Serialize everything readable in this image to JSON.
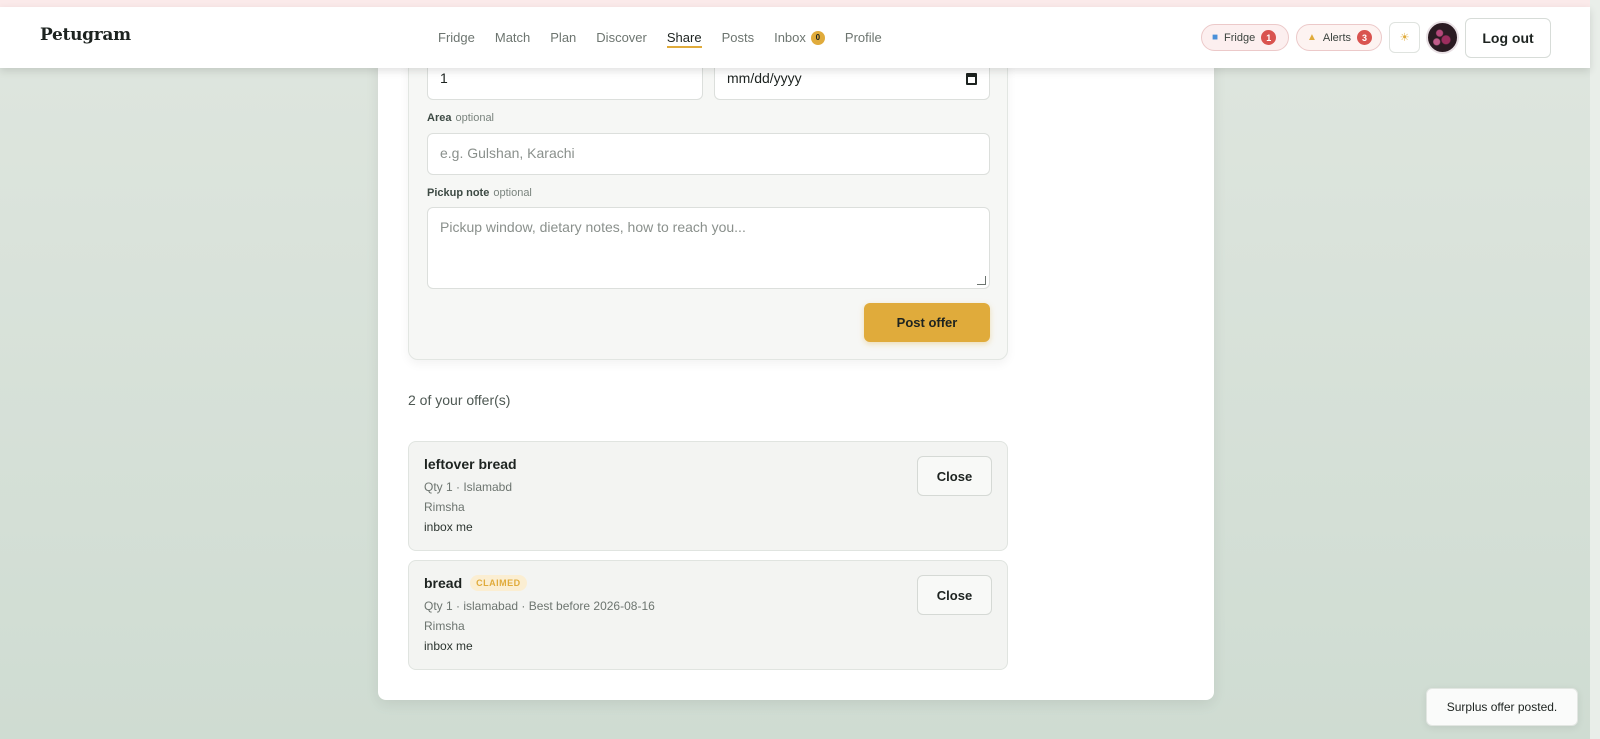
{
  "app": {
    "brand": "Petugram"
  },
  "nav": {
    "items": [
      {
        "label": "Fridge"
      },
      {
        "label": "Match"
      },
      {
        "label": "Plan"
      },
      {
        "label": "Discover"
      },
      {
        "label": "Share",
        "active": true
      },
      {
        "label": "Posts"
      },
      {
        "label": "Inbox",
        "badge": "0"
      },
      {
        "label": "Profile"
      }
    ]
  },
  "header_actions": {
    "fridge": {
      "label": "Fridge",
      "count": "1",
      "icon": "cube-icon"
    },
    "alerts": {
      "label": "Alerts",
      "count": "3",
      "icon": "bell-icon"
    },
    "theme_icon": "sun-icon",
    "logout_label": "Log out"
  },
  "form": {
    "quantity_value": "1",
    "date_placeholder": "mm/dd/yyyy",
    "area_label": "Area",
    "area_optional": "optional",
    "area_placeholder": "e.g. Gulshan, Karachi",
    "note_label": "Pickup note",
    "note_optional": "optional",
    "note_placeholder": "Pickup window, dietary notes, how to reach you...",
    "submit_label": "Post offer"
  },
  "offers": {
    "count_text": "2 of your offer(s)",
    "items": [
      {
        "title": "leftover bread",
        "meta": "Qty 1 · Islamabd",
        "owner": "Rimsha",
        "note": "inbox me",
        "close_label": "Close"
      },
      {
        "title": "bread",
        "status": "CLAIMED",
        "meta": "Qty 1 · islamabad · Best before 2026-08-16",
        "owner": "Rimsha",
        "note": "inbox me",
        "close_label": "Close"
      }
    ]
  },
  "toast": {
    "message": "Surplus offer posted."
  },
  "colors": {
    "accent": "#e0ab3b",
    "badge_red": "#d9534f",
    "background": "#d6e0d8"
  }
}
